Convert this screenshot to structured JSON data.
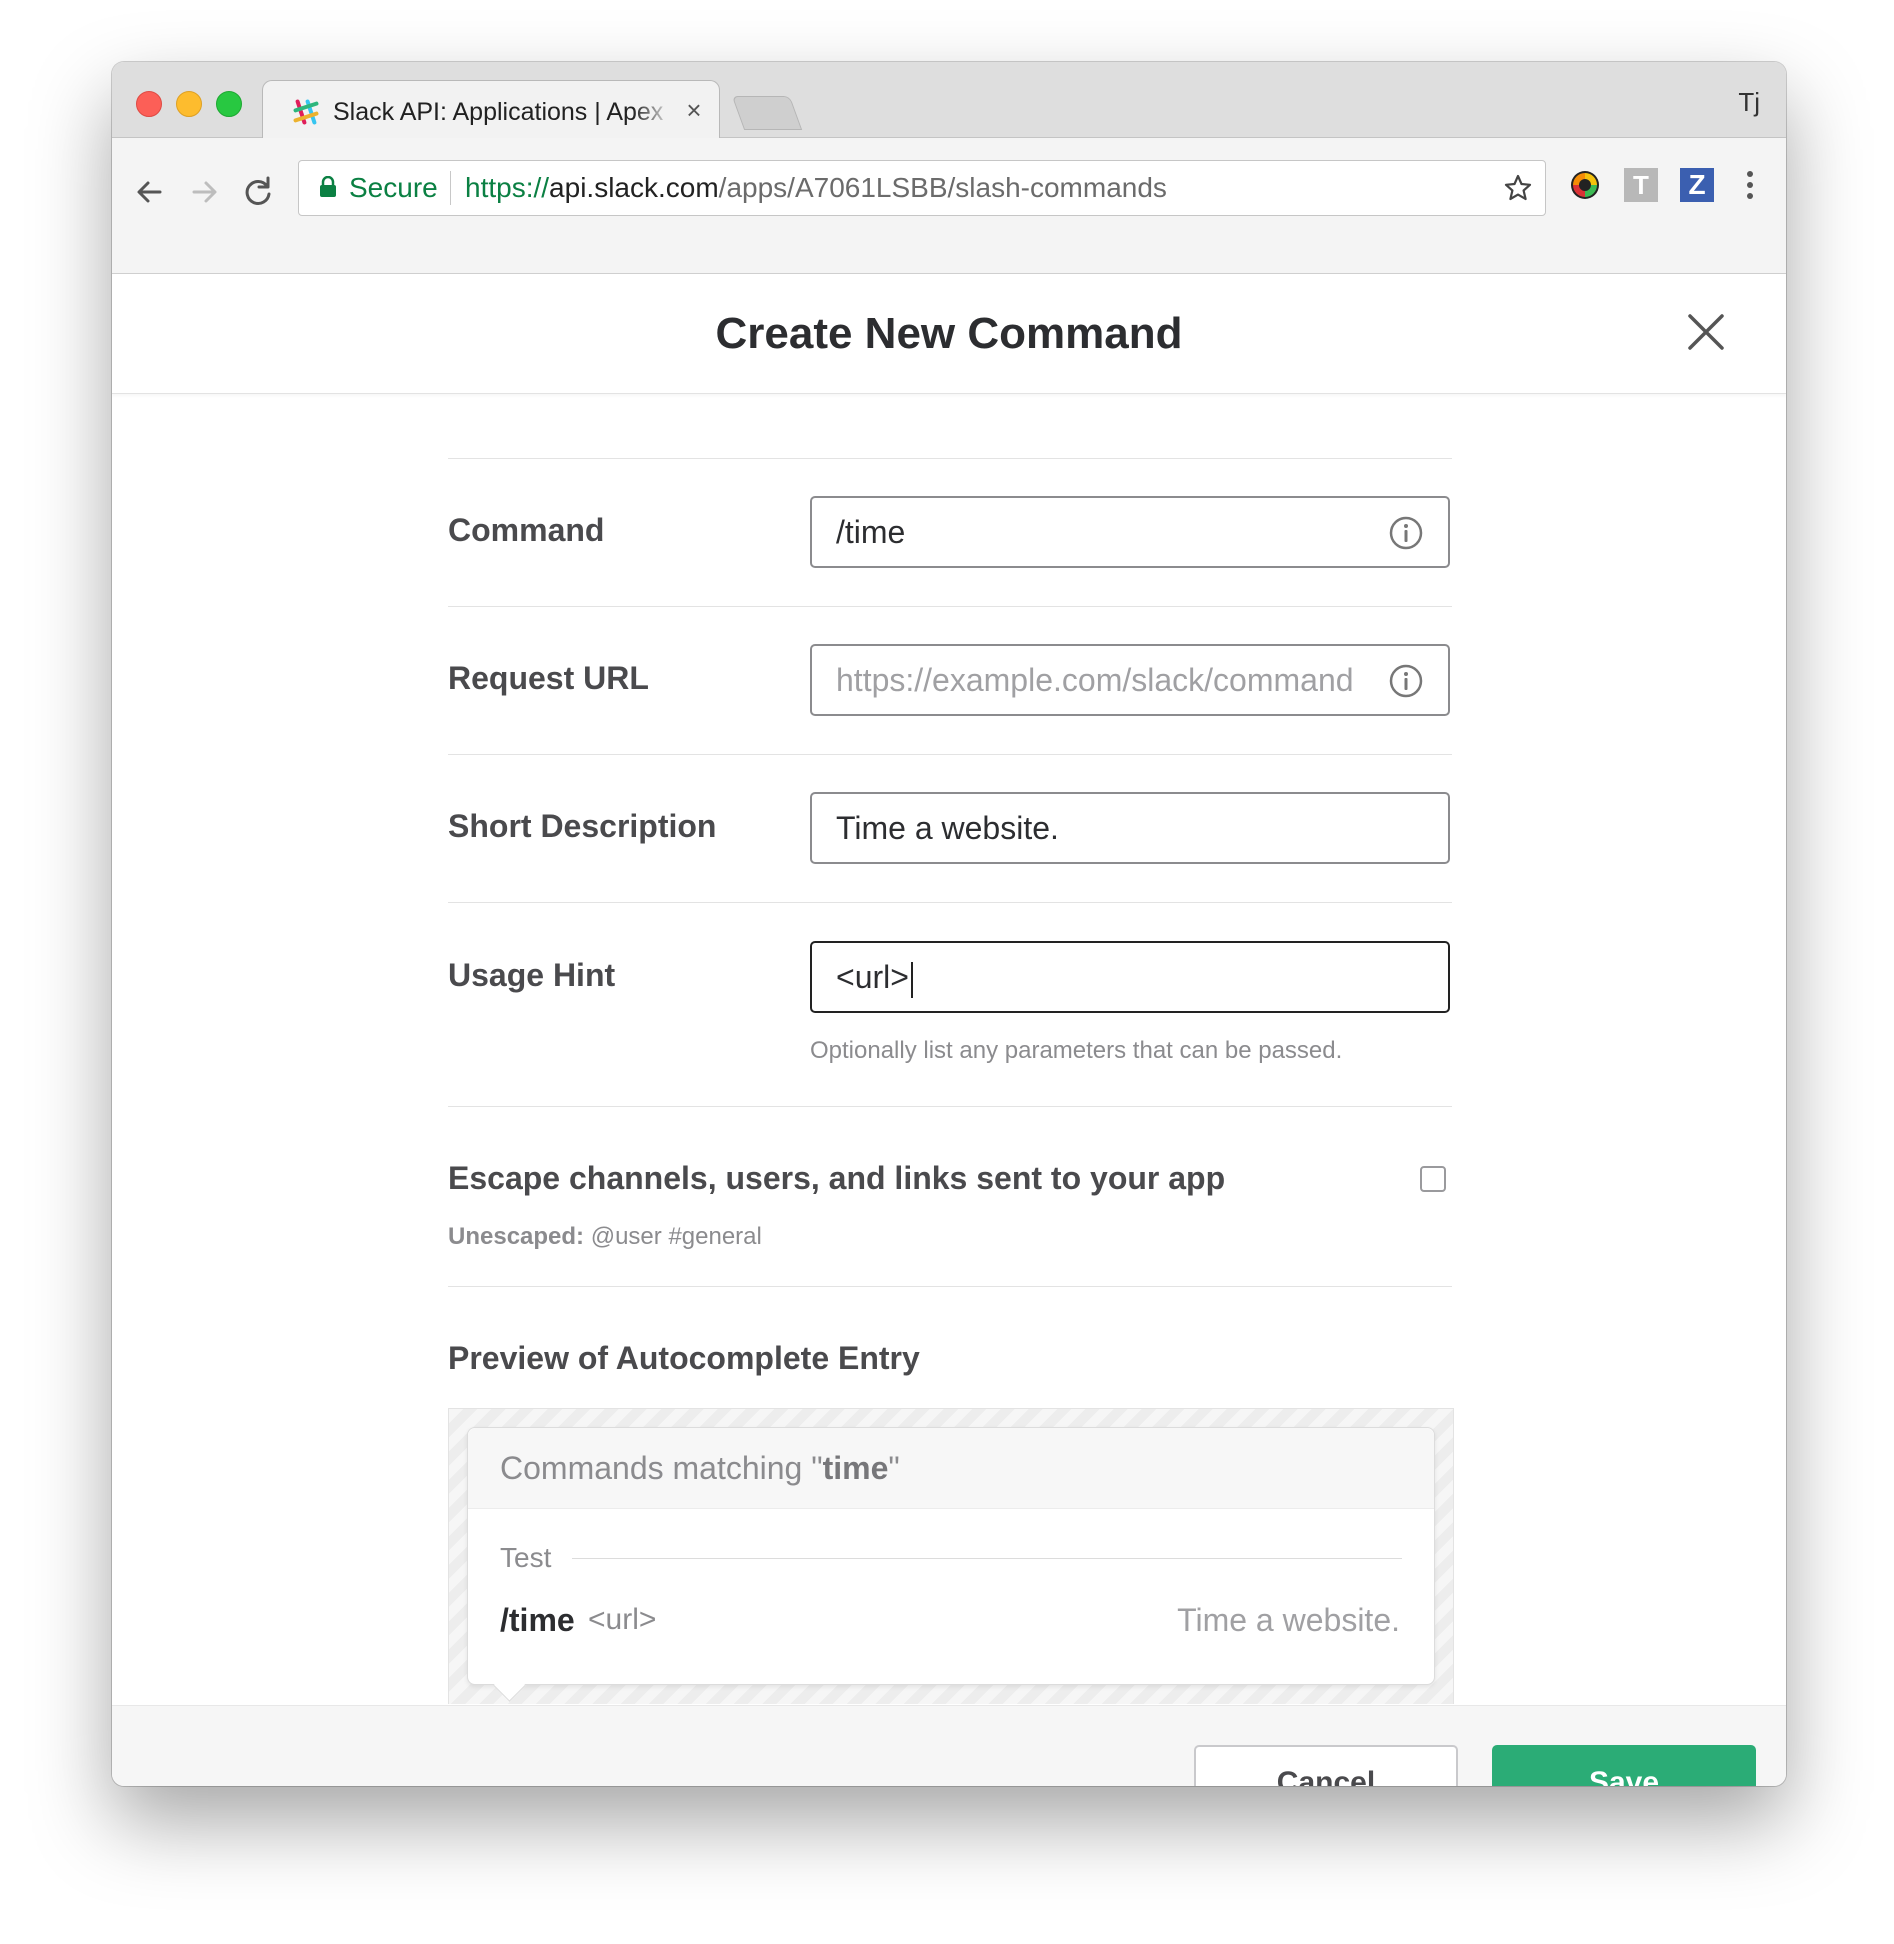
{
  "browser": {
    "tab_title": "Slack API: Applications | Apex",
    "tab_close": "×",
    "profile_initials": "Tj",
    "secure_label": "Secure",
    "url_scheme": "https://",
    "url_host": "api.slack.com",
    "url_path": "/apps/A7061LSBB/slash-commands",
    "extensions": {
      "t_label": "T",
      "z_label": "Z"
    },
    "colors": {
      "secure_green": "#0b8043"
    }
  },
  "modal": {
    "title": "Create New Command",
    "fields": {
      "command": {
        "label": "Command",
        "value": "/time"
      },
      "request_url": {
        "label": "Request URL",
        "value": "",
        "placeholder": "https://example.com/slack/command"
      },
      "short_description": {
        "label": "Short Description",
        "value": "Time a website."
      },
      "usage_hint": {
        "label": "Usage Hint",
        "value": "<url>",
        "help": "Optionally list any parameters that can be passed."
      }
    },
    "escape": {
      "label": "Escape channels, users, and links sent to your app",
      "checked": false,
      "sub_label": "Unescaped:",
      "sub_value": "@user #general"
    },
    "preview": {
      "title": "Preview of Autocomplete Entry",
      "header_prefix": "Commands matching \"",
      "header_query": "time",
      "header_suffix": "\"",
      "group": "Test",
      "command": "/time",
      "hint": "<url>",
      "description": "Time a website."
    },
    "actions": {
      "cancel": "Cancel",
      "save": "Save"
    },
    "colors": {
      "save_green": "#2bac76"
    }
  }
}
